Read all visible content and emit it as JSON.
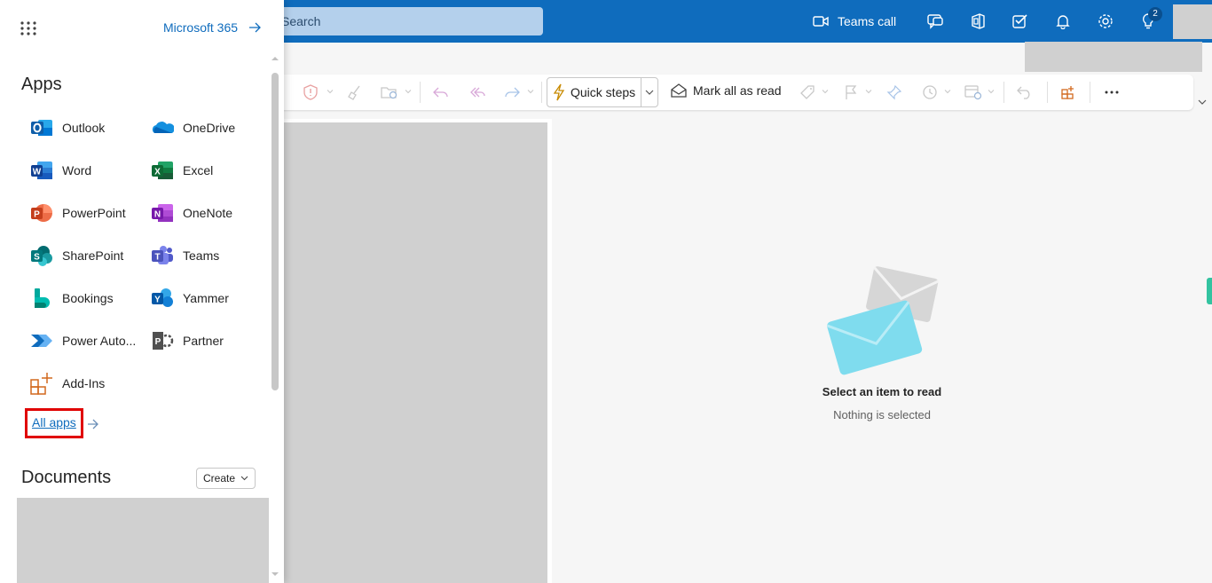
{
  "header": {
    "search_placeholder": "Search",
    "teams_call_label": "Teams call",
    "notification_count": "2"
  },
  "ribbon": {
    "quick_steps_label": "Quick steps",
    "mark_all_read_label": "Mark all as read"
  },
  "reading_pane": {
    "empty_title": "Select an item to read",
    "empty_subtitle": "Nothing is selected"
  },
  "launcher": {
    "m365_label": "Microsoft 365",
    "apps_title": "Apps",
    "apps": [
      {
        "label": "Outlook",
        "icon": "outlook-icon"
      },
      {
        "label": "OneDrive",
        "icon": "onedrive-icon"
      },
      {
        "label": "Word",
        "icon": "word-icon"
      },
      {
        "label": "Excel",
        "icon": "excel-icon"
      },
      {
        "label": "PowerPoint",
        "icon": "powerpoint-icon"
      },
      {
        "label": "OneNote",
        "icon": "onenote-icon"
      },
      {
        "label": "SharePoint",
        "icon": "sharepoint-icon"
      },
      {
        "label": "Teams",
        "icon": "teams-icon"
      },
      {
        "label": "Bookings",
        "icon": "bookings-icon"
      },
      {
        "label": "Yammer",
        "icon": "yammer-icon"
      },
      {
        "label": "Power Auto...",
        "icon": "power-automate-icon"
      },
      {
        "label": "Partner",
        "icon": "partner-icon"
      },
      {
        "label": "Add-Ins",
        "icon": "add-ins-icon"
      }
    ],
    "all_apps_label": "All apps",
    "documents_title": "Documents",
    "create_label": "Create"
  },
  "colors": {
    "header_blue": "#0f6cbd",
    "highlight_red": "#e00000",
    "redacted_gray": "#d0d0d0"
  }
}
